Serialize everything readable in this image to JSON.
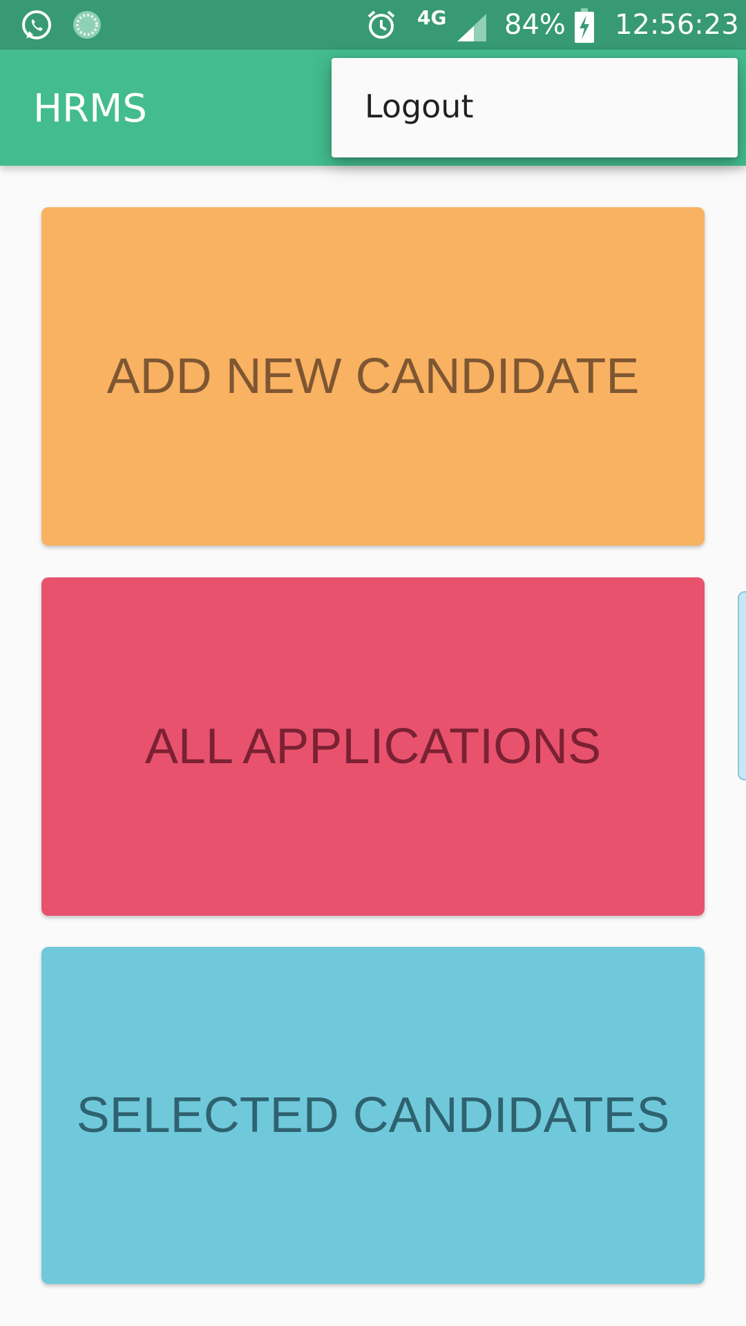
{
  "status_bar": {
    "network": "4G",
    "battery": "84%",
    "time": "12:56:23",
    "icons": [
      "whatsapp-icon",
      "sync-icon",
      "alarm-icon",
      "signal-icon",
      "battery-charging-icon"
    ]
  },
  "app_bar": {
    "title": "HRMS"
  },
  "overflow_menu": {
    "items": [
      {
        "label": "Logout"
      }
    ]
  },
  "tiles": [
    {
      "label": "ADD NEW CANDIDATE",
      "bg": "#f9b261",
      "fg": "#7e5632"
    },
    {
      "label": "ALL APPLICATIONS",
      "bg": "#e8526d",
      "fg": "#7a2133"
    },
    {
      "label": "SELECTED CANDIDATES",
      "bg": "#70c9db",
      "fg": "#2f6270"
    }
  ],
  "colors": {
    "status_bar": "#379a74",
    "app_bar": "#43bc8f",
    "background": "#fafafa"
  }
}
